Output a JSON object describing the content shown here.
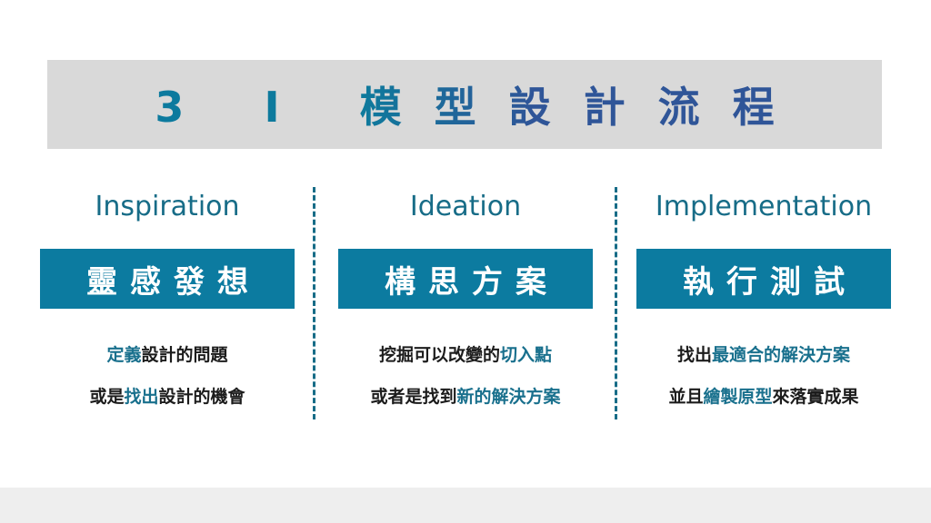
{
  "title": "3 I 模型設計流程",
  "colors": {
    "accent": "#0c7ba0",
    "accent_text": "#176c87",
    "title_gradient_start": "#0b7a9e",
    "title_gradient_end": "#2f5598",
    "title_band": "#d9d9d9",
    "footer_band": "#eeeeee"
  },
  "columns": [
    {
      "english": "Inspiration",
      "chinese": "靈感發想",
      "lines": [
        [
          {
            "text": "定義",
            "hl": true
          },
          {
            "text": "設計的問題",
            "hl": false
          }
        ],
        [
          {
            "text": "或是",
            "hl": false
          },
          {
            "text": "找出",
            "hl": true
          },
          {
            "text": "設計的機會",
            "hl": false
          }
        ]
      ]
    },
    {
      "english": "Ideation",
      "chinese": "構思方案",
      "lines": [
        [
          {
            "text": "挖掘可以改變的",
            "hl": false
          },
          {
            "text": "切入點",
            "hl": true
          }
        ],
        [
          {
            "text": "或者是找到",
            "hl": false
          },
          {
            "text": "新的解決方案",
            "hl": true
          }
        ]
      ]
    },
    {
      "english": "Implementation",
      "chinese": "執行測試",
      "lines": [
        [
          {
            "text": "找出",
            "hl": false
          },
          {
            "text": "最適合的解決方案",
            "hl": true
          }
        ],
        [
          {
            "text": "並且",
            "hl": false
          },
          {
            "text": "繪製原型",
            "hl": true
          },
          {
            "text": "來落實成果",
            "hl": false
          }
        ]
      ]
    }
  ]
}
